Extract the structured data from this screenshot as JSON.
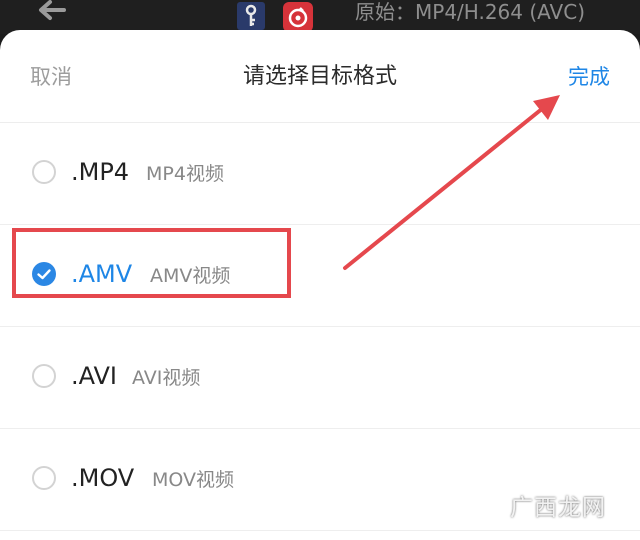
{
  "topbar": {
    "source_info": "原始：MP4/H.264 (AVC)"
  },
  "sheet": {
    "cancel_label": "取消",
    "title": "请选择目标格式",
    "done_label": "完成"
  },
  "options": [
    {
      "ext": ".MP4",
      "desc": "MP4视频",
      "selected": false
    },
    {
      "ext": ".AMV",
      "desc": "AMV视频",
      "selected": true
    },
    {
      "ext": ".AVI",
      "desc": "AVI视频",
      "selected": false
    },
    {
      "ext": ".MOV",
      "desc": "MOV视频",
      "selected": false
    }
  ],
  "colors": {
    "accent": "#1e86e6",
    "annotation": "#e5484d"
  },
  "icons": [
    "back-arrow-icon",
    "key-icon",
    "music-app-icon",
    "check-icon"
  ],
  "watermark": "广西龙网"
}
